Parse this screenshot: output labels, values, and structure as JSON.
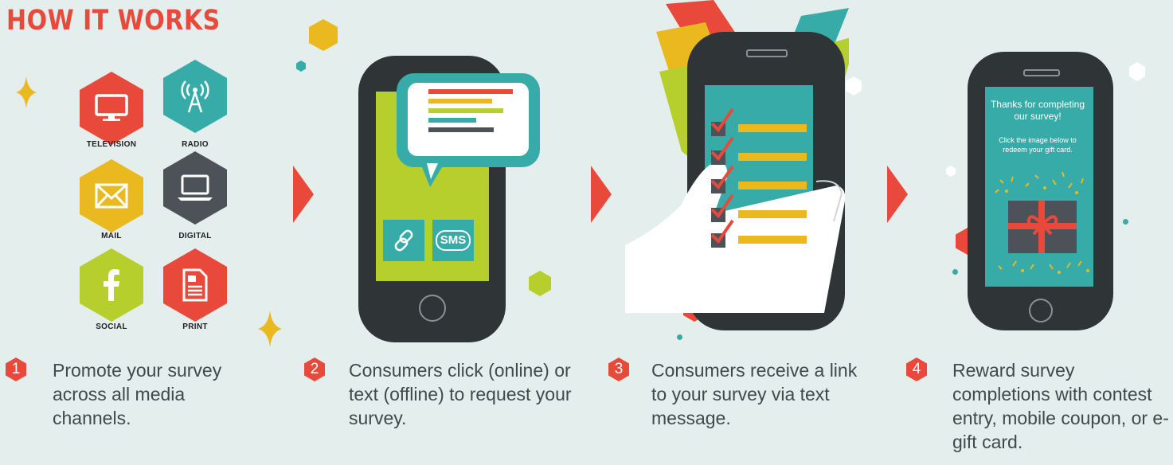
{
  "title": "HOW IT WORKS",
  "colors": {
    "accent": "#e8493a",
    "teal": "#37aba7",
    "yellow": "#eab91f",
    "lime": "#b6cf2d",
    "dark": "#2f3437",
    "background": "#e4eeec"
  },
  "channels": [
    {
      "label": "TELEVISION",
      "icon": "television-icon",
      "color": "#e8493a"
    },
    {
      "label": "RADIO",
      "icon": "radio-tower-icon",
      "color": "#37aba7"
    },
    {
      "label": "MAIL",
      "icon": "envelope-icon",
      "color": "#eab91f"
    },
    {
      "label": "DIGITAL",
      "icon": "laptop-icon",
      "color": "#4d5258"
    },
    {
      "label": "SOCIAL",
      "icon": "facebook-icon",
      "color": "#b6cf2d"
    },
    {
      "label": "PRINT",
      "icon": "document-icon",
      "color": "#e8493a"
    }
  ],
  "phone2": {
    "sms_label": "SMS",
    "link_icon": "link-icon"
  },
  "phone4": {
    "thanks": "Thanks for completing our survey!",
    "instruction": "Click the image below to redeem your gift card.",
    "gift_icon": "gift-card-icon"
  },
  "steps": [
    {
      "number": "1",
      "text": "Promote your survey across all media channels."
    },
    {
      "number": "2",
      "text": "Consumers click (online) or text (offline) to request your survey."
    },
    {
      "number": "3",
      "text": "Consumers receive a link to your survey via text message."
    },
    {
      "number": "4",
      "text": "Reward survey completions with contest entry, mobile coupon, or e-gift card."
    }
  ]
}
